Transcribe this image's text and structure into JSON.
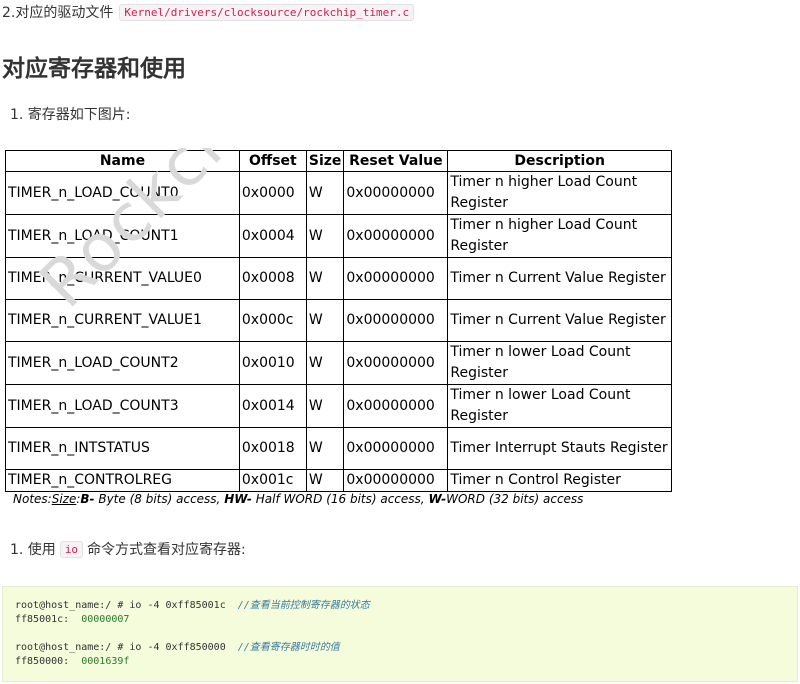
{
  "driver_line": {
    "text": "2.对应的驱动文件",
    "path": "Kernel/drivers/clocksource/rockchip_timer.c"
  },
  "heading": "对应寄存器和使用",
  "list1": "1. 寄存器如下图片:",
  "figure": {
    "watermark": "Rockchip",
    "headers": [
      "Name",
      "Offset",
      "Size",
      "Reset Value",
      "Description"
    ],
    "rows": [
      {
        "name": "TIMER_n_LOAD_COUNT0",
        "offset": "0x0000",
        "size": "W",
        "reset": "0x00000000",
        "desc": "Timer n higher Load Count Register"
      },
      {
        "name": "TIMER_n_LOAD_COUNT1",
        "offset": "0x0004",
        "size": "W",
        "reset": "0x00000000",
        "desc": "Timer n higher Load Count Register"
      },
      {
        "name": "TIMER_n_CURRENT_VALUE0",
        "offset": "0x0008",
        "size": "W",
        "reset": "0x00000000",
        "desc": "Timer n Current Value Register"
      },
      {
        "name": "TIMER_n_CURRENT_VALUE1",
        "offset": "0x000c",
        "size": "W",
        "reset": "0x00000000",
        "desc": "Timer n Current Value Register"
      },
      {
        "name": "TIMER_n_LOAD_COUNT2",
        "offset": "0x0010",
        "size": "W",
        "reset": "0x00000000",
        "desc": "Timer n lower Load Count Register"
      },
      {
        "name": "TIMER_n_LOAD_COUNT3",
        "offset": "0x0014",
        "size": "W",
        "reset": "0x00000000",
        "desc": "Timer n lower Load Count Register"
      },
      {
        "name": "TIMER_n_INTSTATUS",
        "offset": "0x0018",
        "size": "W",
        "reset": "0x00000000",
        "desc": "Timer Interrupt Stauts Register"
      },
      {
        "name": "TIMER_n_CONTROLREG",
        "offset": "0x001c",
        "size": "W",
        "reset": "0x00000000",
        "desc": "Timer n Control Register"
      }
    ],
    "notes": {
      "prefix": "Notes:",
      "size_label": "Size",
      "b": "B-",
      "b_text": " Byte (8 bits) access, ",
      "hw": "HW-",
      "hw_text": " Half WORD (16 bits) access, ",
      "w": "W-",
      "w_text": "WORD (32 bits) access"
    }
  },
  "list2": {
    "prefix": "1. 使用",
    "code": "io",
    "suffix": "命令方式查看对应寄存器:"
  },
  "codeblock": {
    "line1_cmd": "root@host_name:/ # io -4 0xff85001c  ",
    "line1_comment": "//查看当前控制寄存器的状态",
    "line2_addr": "ff85001c:  ",
    "line2_val": "00000007",
    "line3_cmd": "root@host_name:/ # io -4 0xff850000  ",
    "line3_comment": "//查看寄存器时时的值",
    "line4_addr": "ff850000:  ",
    "line4_val": "0001639f"
  }
}
